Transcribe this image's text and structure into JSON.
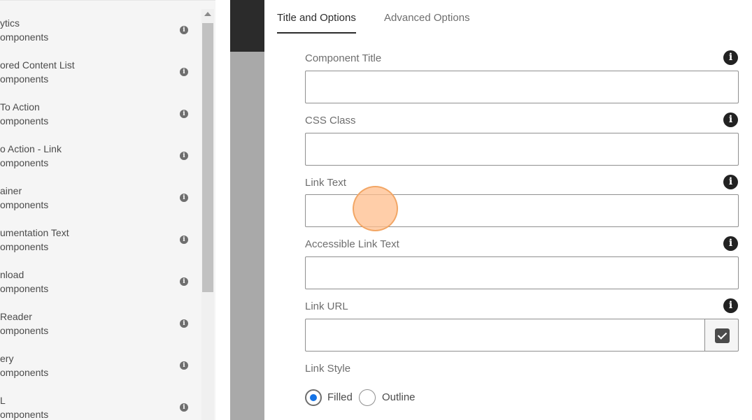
{
  "component_list": [
    {
      "title": "ytics",
      "group": "omponents"
    },
    {
      "title": "ored Content List",
      "group": "omponents"
    },
    {
      "title": "To Action",
      "group": "omponents"
    },
    {
      "title": "o Action - Link",
      "group": "omponents"
    },
    {
      "title": "ainer",
      "group": "omponents"
    },
    {
      "title": "umentation Text",
      "group": "omponents"
    },
    {
      "title": "nload",
      "group": "omponents"
    },
    {
      "title": " Reader",
      "group": "omponents"
    },
    {
      "title": "ery",
      "group": "omponents"
    },
    {
      "title": "L",
      "group": "omponents"
    }
  ],
  "tabs": [
    {
      "label": "Title and Options",
      "active": true
    },
    {
      "label": "Advanced Options",
      "active": false
    }
  ],
  "fields": {
    "component_title": {
      "label": "Component Title",
      "value": "",
      "placeholder": ""
    },
    "css_class": {
      "label": "CSS Class",
      "value": "",
      "placeholder": ""
    },
    "link_text": {
      "label": "Link Text",
      "value": "",
      "placeholder": ""
    },
    "accessible_link_text": {
      "label": "Accessible Link Text",
      "value": "",
      "placeholder": ""
    },
    "link_url": {
      "label": "Link URL",
      "value": "",
      "placeholder": ""
    }
  },
  "link_style": {
    "label": "Link Style",
    "options": [
      {
        "label": "Filled",
        "checked": true
      },
      {
        "label": "Outline",
        "checked": false
      }
    ]
  },
  "icons": {
    "info": "info-icon",
    "picker": "checkbox-check-icon",
    "info_glyph": "i"
  },
  "colors": {
    "accent": "#1473e6",
    "dark_icon": "#222222",
    "highlight": "#ffbe8c"
  }
}
